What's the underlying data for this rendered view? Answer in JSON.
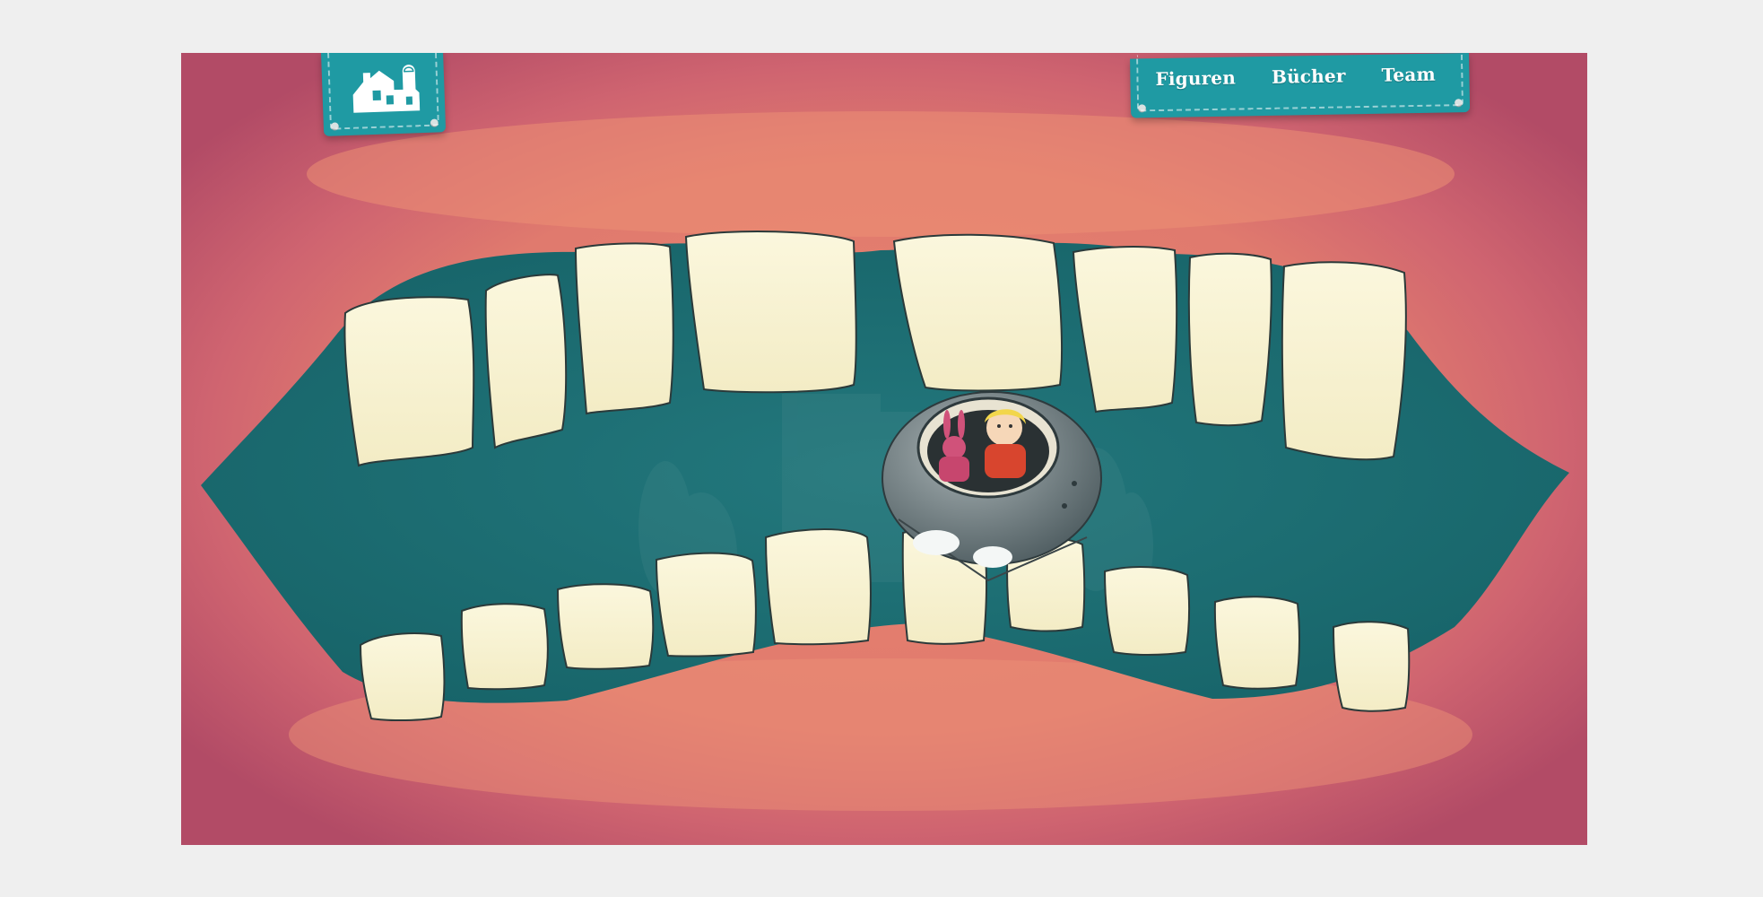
{
  "nav": {
    "home_icon": "house-with-observatory-icon",
    "links": [
      {
        "label": "Figuren"
      },
      {
        "label": "Bücher"
      },
      {
        "label": "Team"
      }
    ]
  },
  "colors": {
    "page_background": "#efefef",
    "lips_outer": "#b9506a",
    "lips_inner": "#e2786f",
    "mouth_interior": "#1c6d72",
    "teeth": "#f8f3d6",
    "tag": "#1f9aa3"
  },
  "illustration": {
    "subject": "open-mouth-with-teeth",
    "center_figure": "child-in-capsule-with-bunny-icon"
  }
}
